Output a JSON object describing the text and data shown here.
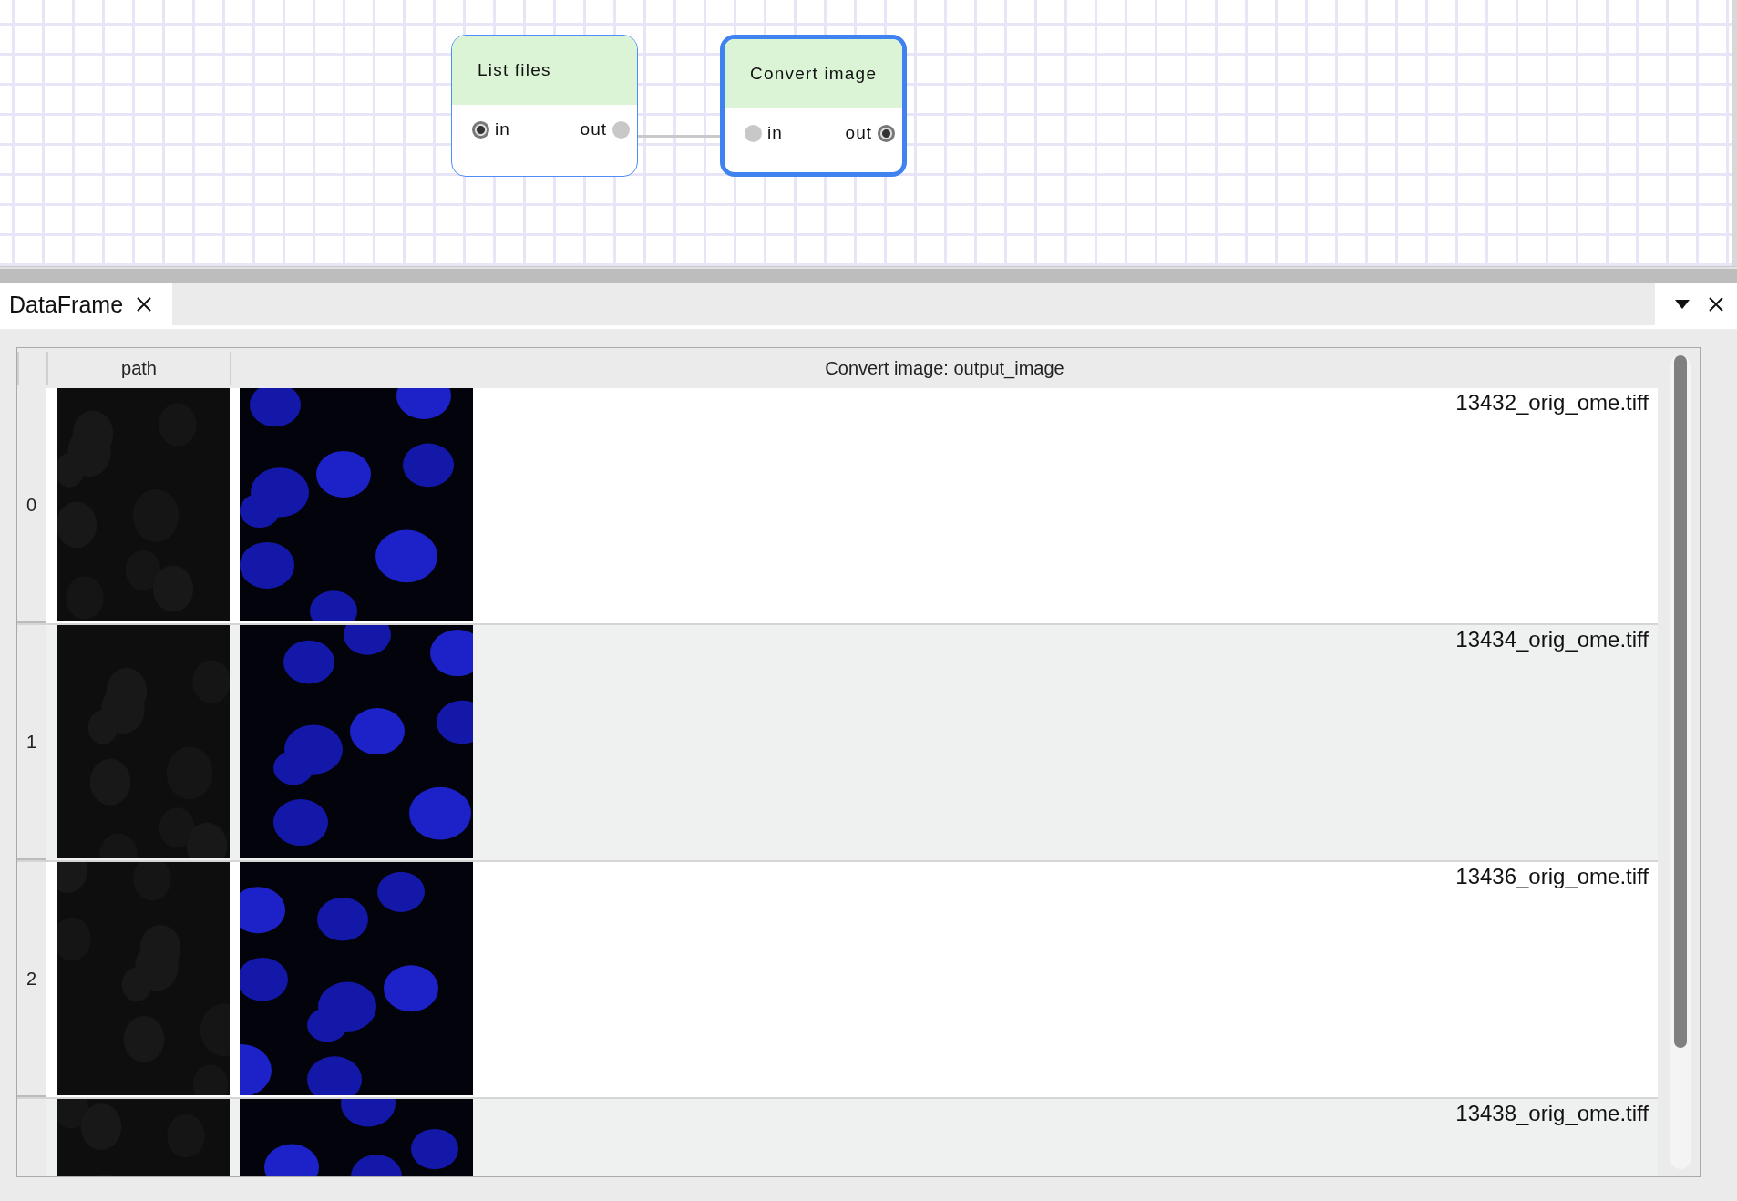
{
  "canvas": {
    "nodes": [
      {
        "title": "List files",
        "selected": false,
        "inputs": [
          {
            "label": "in",
            "connected": false
          }
        ],
        "outputs": [
          {
            "label": "out",
            "connected": true
          }
        ]
      },
      {
        "title": "Convert image",
        "selected": true,
        "inputs": [
          {
            "label": "in",
            "connected": true
          }
        ],
        "outputs": [
          {
            "label": "out",
            "connected": false
          }
        ]
      }
    ]
  },
  "tabs": [
    {
      "label": "DataFrame",
      "selected": true
    }
  ],
  "table": {
    "columns": [
      "path",
      "Convert image: output_image"
    ],
    "rows": [
      {
        "index": "0",
        "file": "13432_orig_ome.tiff"
      },
      {
        "index": "1",
        "file": "13434_orig_ome.tiff"
      },
      {
        "index": "2",
        "file": "13436_orig_ome.tiff"
      },
      {
        "file": "13438_orig_ome.tiff"
      }
    ]
  }
}
